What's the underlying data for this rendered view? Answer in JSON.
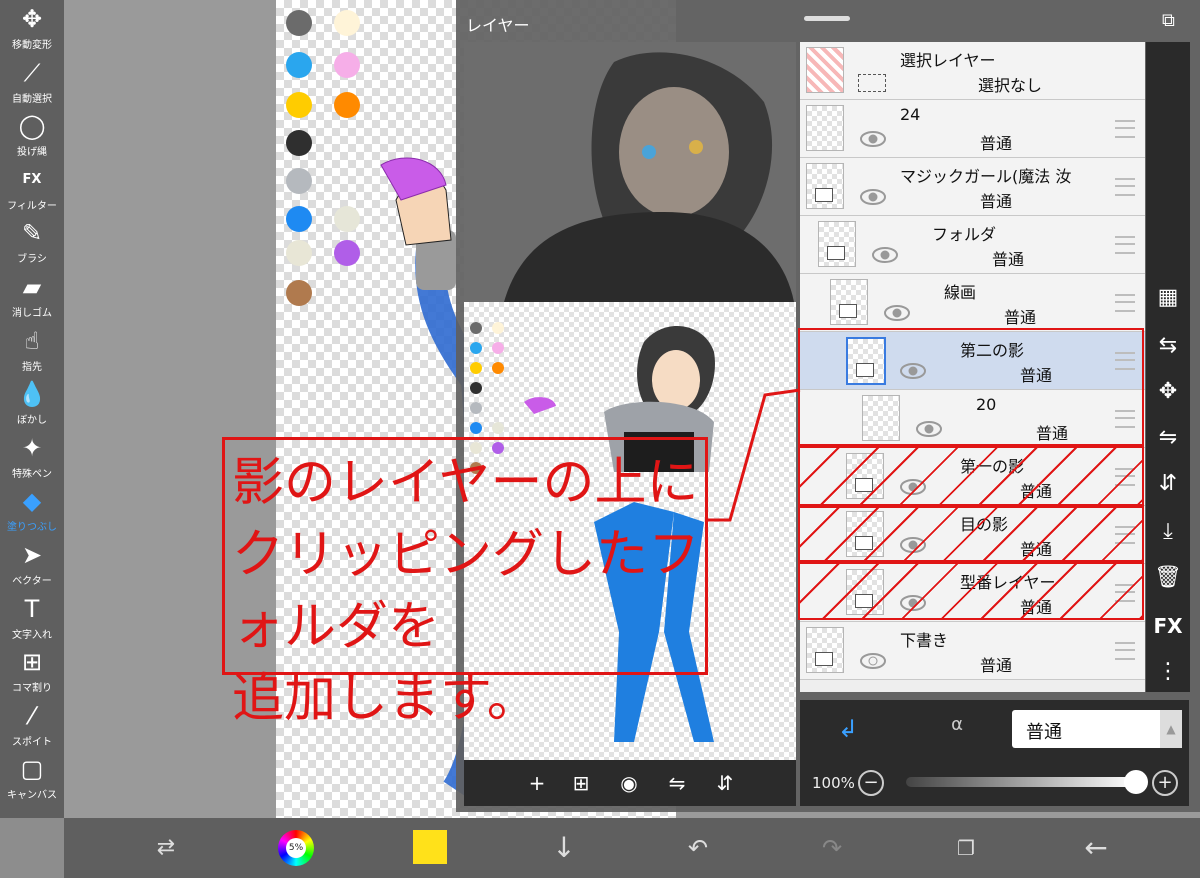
{
  "toolbar": {
    "tools": [
      {
        "label": "移動変形",
        "icon": "move-icon",
        "glyph": "✥"
      },
      {
        "label": "自動選択",
        "icon": "magic-wand-icon",
        "glyph": "⟋"
      },
      {
        "label": "投げ縄",
        "icon": "lasso-icon",
        "glyph": "◯"
      },
      {
        "label": "フィルター",
        "icon": "filter-fx-icon",
        "glyph": "FX"
      },
      {
        "label": "ブラシ",
        "icon": "brush-icon",
        "glyph": "✎"
      },
      {
        "label": "消しゴム",
        "icon": "eraser-icon",
        "glyph": "▰"
      },
      {
        "label": "指先",
        "icon": "finger-icon",
        "glyph": "☝"
      },
      {
        "label": "ぼかし",
        "icon": "blur-drop-icon",
        "glyph": "💧"
      },
      {
        "label": "特殊ペン",
        "icon": "special-pen-icon",
        "glyph": "✦"
      },
      {
        "label": "塗りつぶし",
        "icon": "fill-bucket-icon",
        "glyph": "◆"
      },
      {
        "label": "ベクター",
        "icon": "vector-arrow-icon",
        "glyph": "➤"
      },
      {
        "label": "文字入れ",
        "icon": "text-icon",
        "glyph": "T"
      },
      {
        "label": "コマ割り",
        "icon": "frame-divider-icon",
        "glyph": "⊞"
      },
      {
        "label": "スポイト",
        "icon": "eyedropper-icon",
        "glyph": "⁄"
      },
      {
        "label": "キャンバス",
        "icon": "canvas-icon",
        "glyph": "▢"
      }
    ],
    "active_index": 9,
    "active_color": "#3aa0ff"
  },
  "layer_panel": {
    "title": "レイヤー",
    "layers": [
      {
        "name": "選択レイヤー",
        "mode": "選択なし",
        "kind": "selection"
      },
      {
        "name": "24",
        "mode": "普通",
        "kind": "layer"
      },
      {
        "name": "マジックガール(魔法 汝",
        "mode": "普通",
        "kind": "folder"
      },
      {
        "name": "フォルダ",
        "mode": "普通",
        "kind": "folder"
      },
      {
        "name": "線画",
        "mode": "普通",
        "kind": "folder"
      },
      {
        "name": "第二の影",
        "mode": "普通",
        "kind": "folder",
        "selected": true
      },
      {
        "name": "20",
        "mode": "普通",
        "kind": "layer"
      },
      {
        "name": "第一の影",
        "mode": "普通",
        "kind": "folder"
      },
      {
        "name": "目の影",
        "mode": "普通",
        "kind": "folder"
      },
      {
        "name": "型番レイヤー",
        "mode": "普通",
        "kind": "folder"
      },
      {
        "name": "下書き",
        "mode": "普通",
        "kind": "folder"
      }
    ],
    "blend_mode": "普通",
    "opacity": "100%",
    "opacity_value": 1.0,
    "alpha_lock_label": "α",
    "fx_label": "FX"
  },
  "annotation": {
    "lines": [
      "影のレイヤーの上に",
      "クリッピングしたフォルダを",
      "追加します。"
    ],
    "color": "#e01515"
  },
  "palette": {
    "colors": [
      "#6b6b6b",
      "#fff4d8",
      "#2aa6ee",
      "#f6aee8",
      "#ffcc00",
      "#ff8a00",
      "#2f2f2f",
      "#b5b9be",
      "#1e8af2",
      "#e6e6d8",
      "#e8e6d6",
      "#b05ee8",
      "#b07a4e"
    ]
  },
  "bottom_bar": {
    "current_color": "#ffe11a",
    "wheel_label": "5%"
  }
}
